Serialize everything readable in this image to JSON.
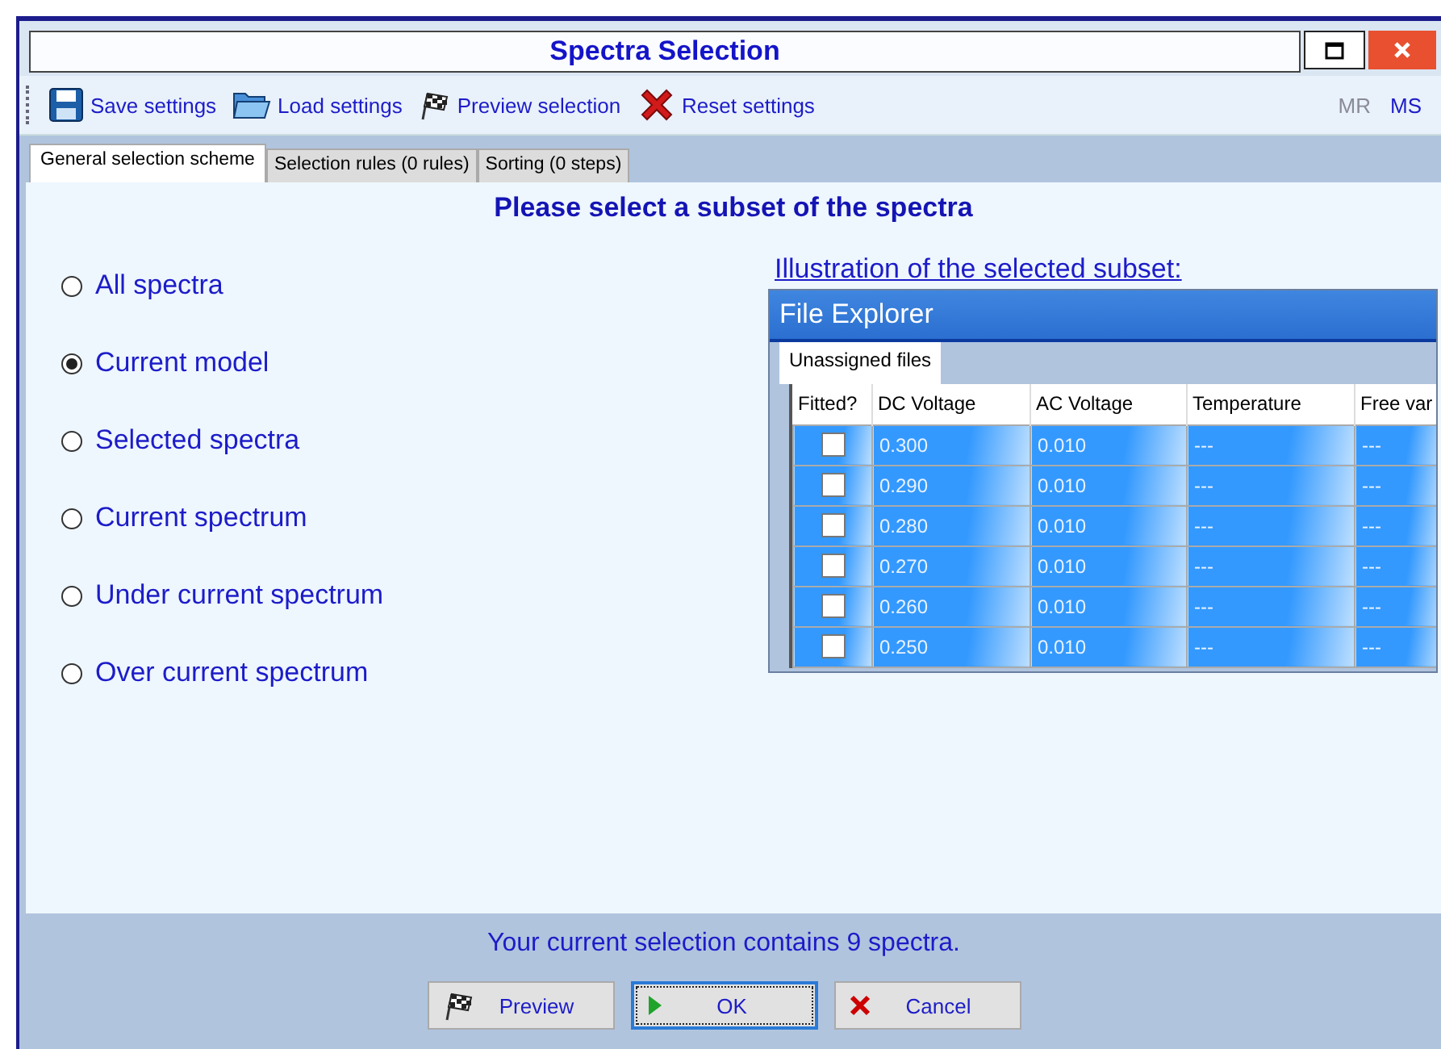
{
  "window": {
    "title": "Spectra Selection"
  },
  "toolbar": {
    "items": [
      {
        "kind": "save",
        "label": "Save settings"
      },
      {
        "kind": "load",
        "label": "Load settings"
      },
      {
        "kind": "preview",
        "label": "Preview selection"
      },
      {
        "kind": "reset",
        "label": "Reset settings"
      }
    ],
    "right_items": [
      {
        "label": "MR",
        "disabled": true
      },
      {
        "label": "MS",
        "disabled": false
      }
    ]
  },
  "tabs": [
    {
      "label": "General selection scheme",
      "selected": true
    },
    {
      "label": "Selection rules (0 rules)",
      "selected": false
    },
    {
      "label": "Sorting (0 steps)",
      "selected": false
    }
  ],
  "heading": "Please select a subset of the spectra",
  "options": [
    {
      "label": "All spectra",
      "selected": false
    },
    {
      "label": "Current model",
      "selected": true
    },
    {
      "label": "Selected spectra",
      "selected": false
    },
    {
      "label": "Current spectrum",
      "selected": false
    },
    {
      "label": "Under current spectrum",
      "selected": false
    },
    {
      "label": "Over current spectrum",
      "selected": false
    }
  ],
  "illustration": {
    "caption": "Illustration of the selected subset:",
    "title": "File Explorer",
    "tab": "Unassigned files",
    "fitted_header": "Fitted?",
    "columns": [
      "DC Voltage",
      "AC Voltage",
      "Temperature",
      "Free var"
    ],
    "rows": [
      {
        "fitted": false,
        "cells": [
          "0.300",
          "0.010",
          "---",
          "---"
        ]
      },
      {
        "fitted": false,
        "cells": [
          "0.290",
          "0.010",
          "---",
          "---"
        ]
      },
      {
        "fitted": false,
        "cells": [
          "0.280",
          "0.010",
          "---",
          "---"
        ]
      },
      {
        "fitted": false,
        "cells": [
          "0.270",
          "0.010",
          "---",
          "---"
        ]
      },
      {
        "fitted": false,
        "cells": [
          "0.260",
          "0.010",
          "---",
          "---"
        ]
      },
      {
        "fitted": false,
        "cells": [
          "0.250",
          "0.010",
          "---",
          "---"
        ]
      }
    ]
  },
  "status": "Your current selection contains 9 spectra.",
  "buttons": [
    {
      "kind": "preview",
      "label": "Preview",
      "focused": false
    },
    {
      "kind": "ok",
      "label": "OK",
      "focused": true
    },
    {
      "kind": "cancel",
      "label": "Cancel",
      "focused": false
    }
  ]
}
